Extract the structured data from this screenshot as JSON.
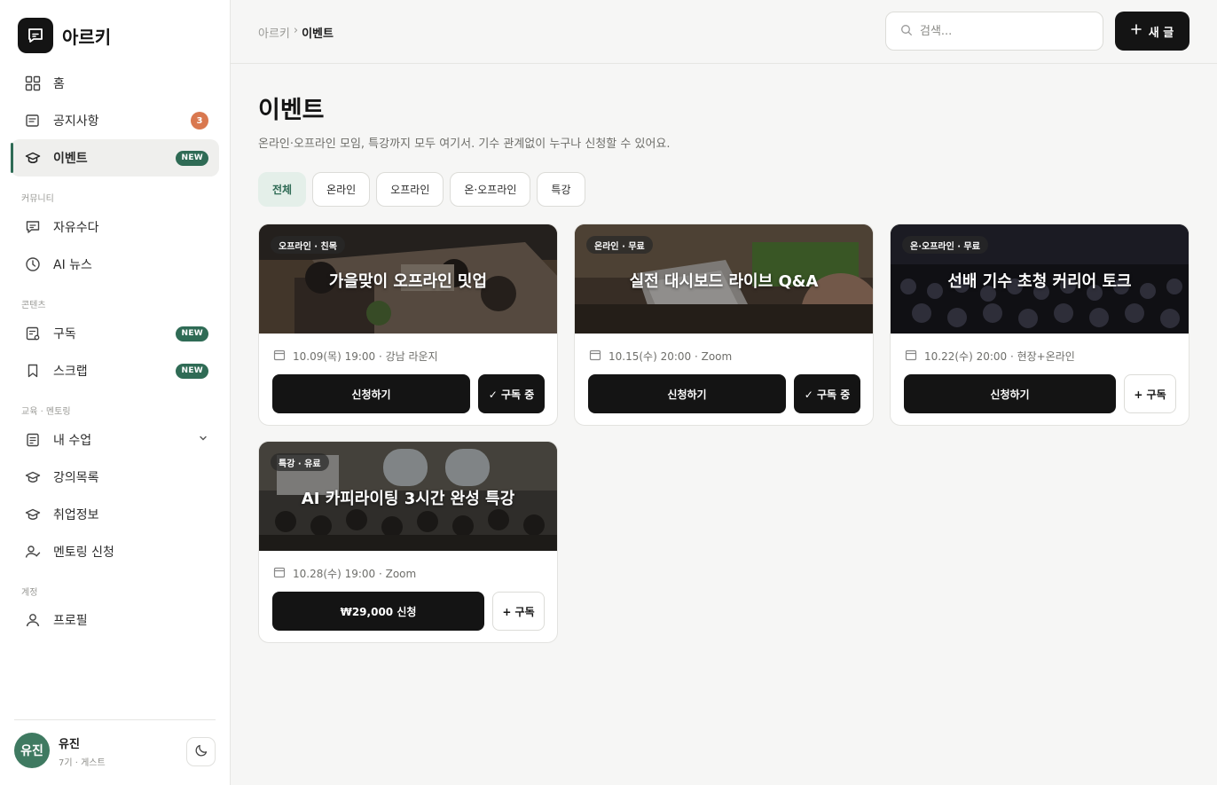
{
  "brand": {
    "name": "아르키"
  },
  "nav": {
    "items": [
      {
        "label": "홈",
        "icon": "grid-icon"
      },
      {
        "label": "공지사항",
        "icon": "notice-icon",
        "badge": "3"
      },
      {
        "label": "이벤트",
        "icon": "graduation-cap-icon",
        "badge": "NEW"
      }
    ],
    "community_label": "커뮤니티",
    "community": [
      {
        "label": "자유수다",
        "icon": "chat-icon"
      },
      {
        "label": "AI 뉴스",
        "icon": "clock-icon"
      }
    ],
    "content_label": "콘텐츠",
    "content": [
      {
        "label": "구독",
        "icon": "subscribe-icon",
        "badge": "NEW"
      },
      {
        "label": "스크랩",
        "icon": "bookmark-icon",
        "badge": "NEW"
      }
    ],
    "edu_label": "교육 · 멘토링",
    "edu": [
      {
        "label": "내 수업",
        "icon": "document-icon"
      },
      {
        "label": "강의목록",
        "icon": "graduation-cap-icon"
      },
      {
        "label": "취업정보",
        "icon": "graduation-cap-icon"
      },
      {
        "label": "멘토링 신청",
        "icon": "user-check-icon"
      }
    ],
    "account_label": "계정",
    "account": [
      {
        "label": "프로필",
        "icon": "user-icon"
      }
    ]
  },
  "user": {
    "avatar": "유진",
    "name": "유진",
    "meta": "7기 · 게스트"
  },
  "header": {
    "breadcrumb_root": "아르키",
    "breadcrumb_sep": "›",
    "breadcrumb_current": "이벤트",
    "search_placeholder": "검색...",
    "new_button": "새 글"
  },
  "page": {
    "title": "이벤트",
    "description": "온라인·오프라인 모임, 특강까지 모두 여기서. 기수 관계없이 누구나 신청할 수 있어요."
  },
  "filters": [
    "전체",
    "온라인",
    "오프라인",
    "온·오프라인",
    "특강"
  ],
  "events": [
    {
      "tag": "오프라인 · 친목",
      "title": "가을맞이 오프라인 밋업",
      "meta": "10.09(목) 19:00 · 강남 라운지",
      "apply": "신청하기",
      "subscribe": "✓ 구독 중"
    },
    {
      "tag": "온라인 · 무료",
      "title": "실전 대시보드 라이브 Q&A",
      "meta": "10.15(수) 20:00 · Zoom",
      "apply": "신청하기",
      "subscribe": "✓ 구독 중"
    },
    {
      "tag": "온·오프라인 · 무료",
      "title": "선배 기수 초청 커리어 토크",
      "meta": "10.22(수) 20:00 · 현장+온라인",
      "apply": "신청하기",
      "subscribe": "+ 구독"
    },
    {
      "tag": "특강 · 유료",
      "title": "AI 카피라이팅 3시간 완성 특강",
      "meta": "10.28(수) 19:00 · Zoom",
      "apply": "₩29,000 신청",
      "subscribe": "+ 구독"
    }
  ],
  "colors": {
    "accent": "#2f6b55",
    "badge_orange": "#d9784f",
    "dark": "#141414"
  }
}
